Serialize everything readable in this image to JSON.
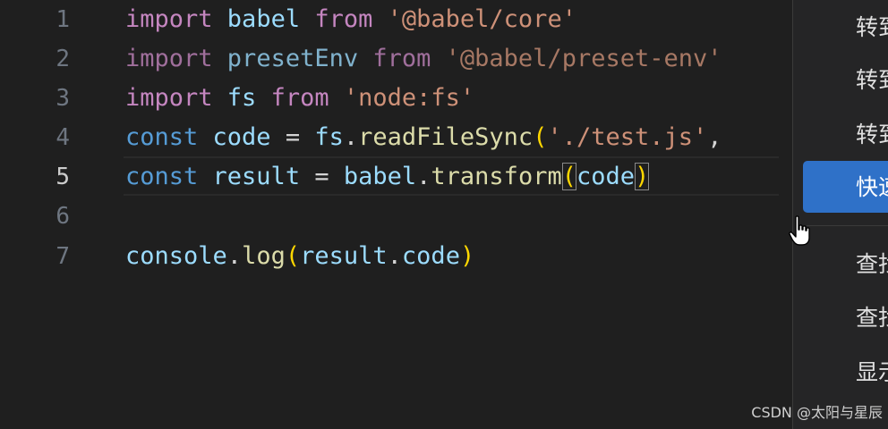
{
  "editor": {
    "active_line": 5,
    "lines": [
      {
        "num": "1",
        "tokens": {
          "t1": "import",
          "t2": " babel ",
          "t3": "from",
          "t4": " '@babel/core'"
        }
      },
      {
        "num": "2",
        "tokens": {
          "t1": "import",
          "t2": " presetEnv ",
          "t3": "from",
          "t4": " '@babel/preset-env'"
        }
      },
      {
        "num": "3",
        "tokens": {
          "t1": "import",
          "t2": " fs ",
          "t3": "from",
          "t4": " 'node:fs'"
        }
      },
      {
        "num": "4",
        "tokens": {
          "t1": "const",
          "t2": " code",
          "t3": " = ",
          "t4": "fs",
          "t5": ".",
          "t6": "readFileSync",
          "t7": "(",
          "t8": "'./test.js'",
          "t9": ","
        }
      },
      {
        "num": "5",
        "tokens": {
          "t1": "const",
          "t2": " result",
          "t3": " = ",
          "t4": "babel",
          "t5": ".",
          "t6": "transform",
          "t7": "(",
          "t8": "code",
          "t9": ")"
        }
      },
      {
        "num": "6",
        "tokens": {}
      },
      {
        "num": "7",
        "tokens": {
          "t1": "console",
          "t2": ".",
          "t3": "log",
          "t4": "(",
          "t5": "result",
          "t6": ".",
          "t7": "code",
          "t8": ")"
        }
      }
    ]
  },
  "context_menu": {
    "items": [
      "转到",
      "转到",
      "转到",
      "快速",
      "查找",
      "查找",
      "显示"
    ],
    "highlighted_index": 3
  },
  "watermark": "CSDN @太阳与星辰",
  "colors": {
    "background": "#1f1f1f",
    "keyword_import": "#c586c0",
    "keyword_const": "#569cd6",
    "variable": "#9cdcfe",
    "string": "#ce9178",
    "function": "#dcdcaa",
    "bracket": "#ffd700",
    "menu_highlight": "#2f71c8"
  },
  "icons": {
    "cursor": "hand-pointer-icon"
  }
}
